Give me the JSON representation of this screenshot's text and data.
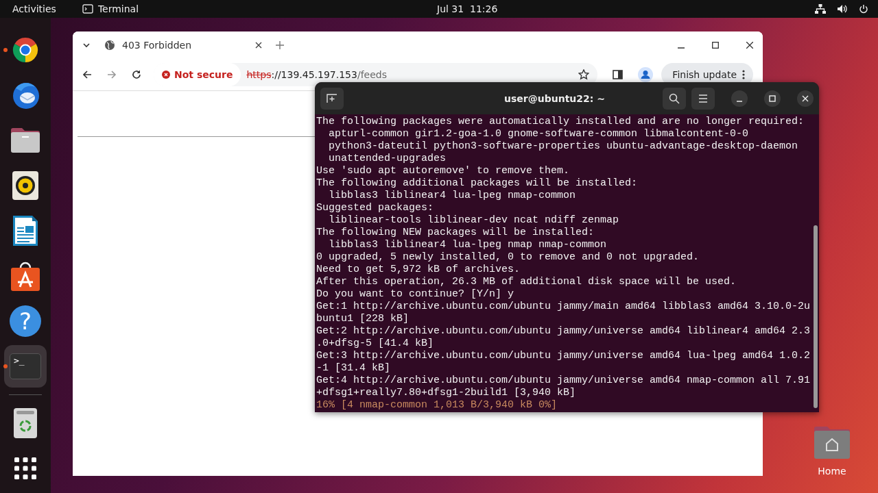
{
  "top_bar": {
    "activities": "Activities",
    "app_menu": "Terminal",
    "clock": "Jul 31  11:26"
  },
  "dock": {
    "apps": [
      {
        "kind": "chrome",
        "running": true,
        "selected": false
      },
      {
        "kind": "mail",
        "running": false,
        "selected": false
      },
      {
        "kind": "files",
        "running": false,
        "selected": false
      },
      {
        "kind": "music",
        "running": false,
        "selected": false
      },
      {
        "kind": "writer",
        "running": false,
        "selected": false
      },
      {
        "kind": "software",
        "running": false,
        "selected": false
      },
      {
        "kind": "help",
        "glyph": "?",
        "running": false,
        "selected": false
      },
      {
        "kind": "terminal",
        "glyph": ">_",
        "running": true,
        "selected": true
      }
    ]
  },
  "browser": {
    "tab_title": "403 Forbidden",
    "security": "Not secure",
    "url": {
      "scheme": "https",
      "host": "://139.45.197.153",
      "path": "/feeds"
    },
    "update_button": "Finish update"
  },
  "terminal": {
    "title": "user@ubuntu22: ~",
    "lines": [
      {
        "kind": "output",
        "text": "The following packages were automatically installed and are no longer required:"
      },
      {
        "kind": "output",
        "text": "  apturl-common gir1.2-goa-1.0 gnome-software-common libmalcontent-0-0"
      },
      {
        "kind": "output",
        "text": "  python3-dateutil python3-software-properties ubuntu-advantage-desktop-daemon"
      },
      {
        "kind": "output",
        "text": "  unattended-upgrades"
      },
      {
        "kind": "output",
        "text": "Use 'sudo apt autoremove' to remove them."
      },
      {
        "kind": "output",
        "text": "The following additional packages will be installed:"
      },
      {
        "kind": "output",
        "text": "  libblas3 liblinear4 lua-lpeg nmap-common"
      },
      {
        "kind": "output",
        "text": "Suggested packages:"
      },
      {
        "kind": "output",
        "text": "  liblinear-tools liblinear-dev ncat ndiff zenmap"
      },
      {
        "kind": "output",
        "text": "The following NEW packages will be installed:"
      },
      {
        "kind": "output",
        "text": "  libblas3 liblinear4 lua-lpeg nmap nmap-common"
      },
      {
        "kind": "output",
        "text": "0 upgraded, 5 newly installed, 0 to remove and 0 not upgraded."
      },
      {
        "kind": "output",
        "text": "Need to get 5,972 kB of archives."
      },
      {
        "kind": "output",
        "text": "After this operation, 26.3 MB of additional disk space will be used."
      },
      {
        "kind": "output",
        "text": "Do you want to continue? [Y/n] y"
      },
      {
        "kind": "output",
        "text": "Get:1 http://archive.ubuntu.com/ubuntu jammy/main amd64 libblas3 amd64 3.10.0-2u"
      },
      {
        "kind": "output",
        "text": "buntu1 [228 kB]"
      },
      {
        "kind": "output",
        "text": "Get:2 http://archive.ubuntu.com/ubuntu jammy/universe amd64 liblinear4 amd64 2.3"
      },
      {
        "kind": "output",
        "text": ".0+dfsg-5 [41.4 kB]"
      },
      {
        "kind": "output",
        "text": "Get:3 http://archive.ubuntu.com/ubuntu jammy/universe amd64 lua-lpeg amd64 1.0.2"
      },
      {
        "kind": "output",
        "text": "-1 [31.4 kB]"
      },
      {
        "kind": "output",
        "text": "Get:4 http://archive.ubuntu.com/ubuntu jammy/universe amd64 nmap-common all 7.91"
      },
      {
        "kind": "output",
        "text": "+dfsg1+really7.80+dfsg1-2build1 [3,940 kB]"
      },
      {
        "kind": "progress",
        "text": "16% [4 nmap-common 1,013 B/3,940 kB 0%]"
      }
    ]
  },
  "desktop_icons": [
    {
      "label": "Home"
    }
  ]
}
